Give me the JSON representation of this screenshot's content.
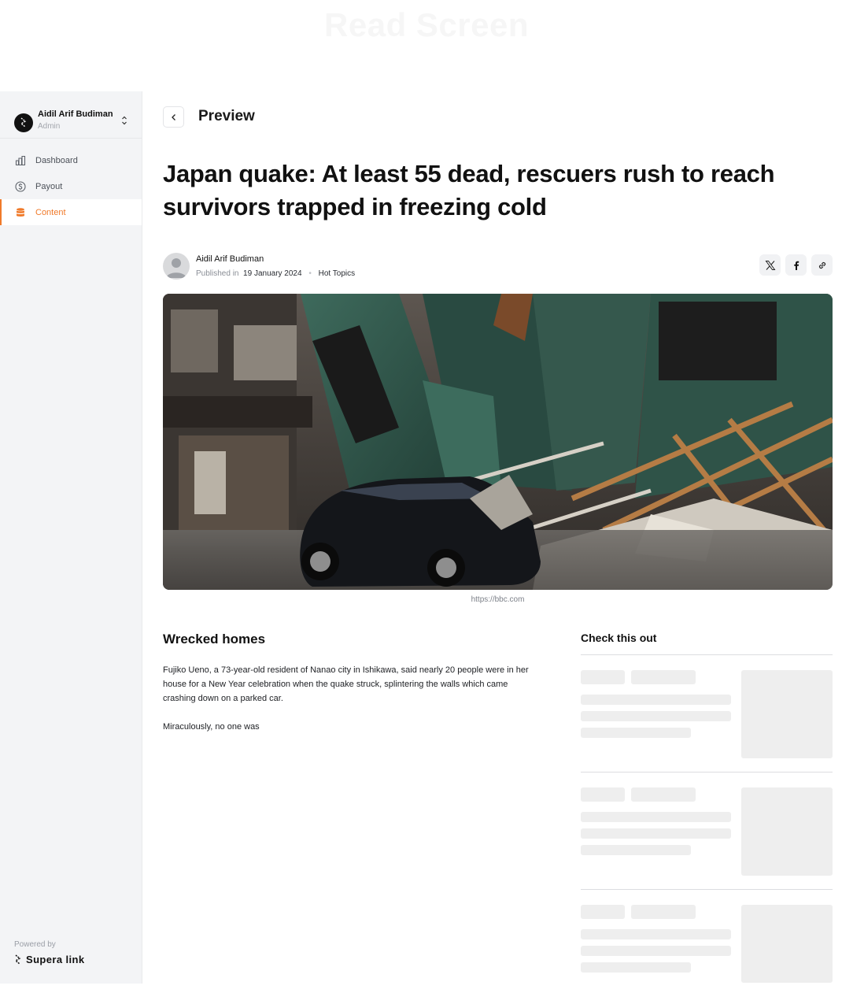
{
  "canvas": {
    "title": "Read Screen"
  },
  "sidebar": {
    "user": {
      "name": "Aidil Arif Budiman",
      "role": "Admin"
    },
    "nav": [
      {
        "label": "Dashboard",
        "icon": "chart-bar-icon",
        "active": false
      },
      {
        "label": "Payout",
        "icon": "dollar-circle-icon",
        "active": false
      },
      {
        "label": "Content",
        "icon": "database-icon",
        "active": true
      }
    ],
    "footer": {
      "powered_label": "Powered by",
      "brand": "Supera link"
    }
  },
  "header": {
    "title": "Preview",
    "back_icon": "chevron-left-icon"
  },
  "article": {
    "headline": "Japan quake: At least 55 dead, rescuers rush to reach survivors trapped in freezing cold",
    "author": "Aidil Arif Budiman",
    "published_label": "Published in",
    "date": "19 January 2024",
    "category": "Hot Topics",
    "share": [
      "x-icon",
      "facebook-icon",
      "link-icon"
    ],
    "image_caption": "https://bbc.com",
    "section_title": "Wrecked homes",
    "paragraphs": [
      "Fujiko Ueno, a 73-year-old resident of Nanao city in Ishikawa, said nearly 20 people were in her house for a New Year celebration when the quake struck, splintering the walls which came crashing down on a parked car.",
      "Miraculously, no one was"
    ]
  },
  "aside": {
    "title": "Check this out"
  },
  "colors": {
    "accent": "#f07a2a",
    "sidebar_bg": "#f3f4f6",
    "skeleton": "#eeeeee"
  }
}
